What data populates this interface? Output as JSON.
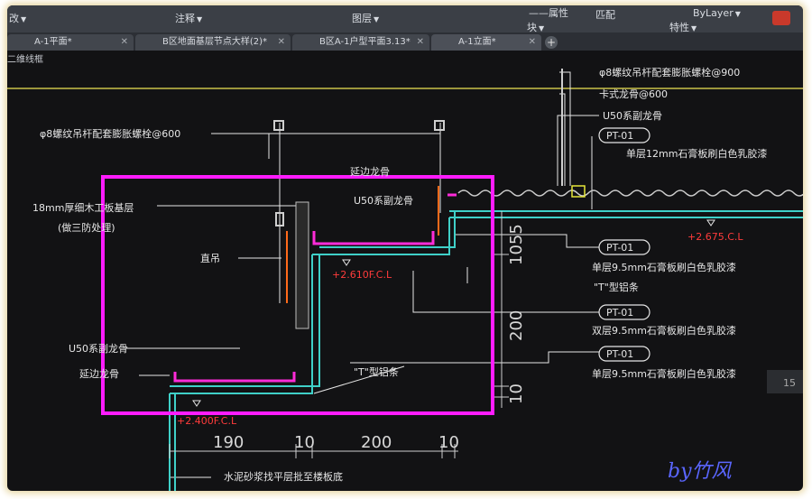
{
  "ribbon": {
    "left_label": "改",
    "annotation_label": "注释",
    "layer_label": "图层",
    "block_label": "块",
    "properties_label": "特性",
    "match_label": "匹配",
    "color_value": "ByLayer",
    "partial_label": "——属性"
  },
  "tabs": [
    {
      "label": "A-1平面*"
    },
    {
      "label": "B区地面基层节点大样(2)*"
    },
    {
      "label": "B区A-1户型平面3.13*"
    },
    {
      "label": "A-1立面*"
    }
  ],
  "new_tab_symbol": "+",
  "viewport_label": "二维线框",
  "drawing": {
    "callouts": {
      "top_bolt": "φ8螺纹吊杆配套膨胀螺栓@900",
      "left_bolt": "φ8螺纹吊杆配套膨胀螺栓@600",
      "clip_keel": "卡式龙骨@600",
      "u50_top": "U50系副龙骨",
      "u50_mid": "U50系副龙骨",
      "u50_left": "U50系副龙骨",
      "edge_keel_top": "延边龙骨",
      "edge_keel_left": "延边龙骨",
      "plywood_1": "18mm厚细木工板基层",
      "plywood_2": "(做三防处理)",
      "hanger": "直吊",
      "t_strip_1": "\"T\"型铝条",
      "t_strip_2": "\"T\"型铝条",
      "cement": "水泥砂浆找平层批至楼板底"
    },
    "pt_tags": [
      "PT-01",
      "PT-01",
      "PT-01",
      "PT-01"
    ],
    "pt_descriptions": [
      "单层12mm石膏板刷白色乳胶漆",
      "单层9.5mm石膏板刷白色乳胶漆",
      "双层9.5mm石膏板刷白色乳胶漆",
      "单层9.5mm石膏板刷白色乳胶漆"
    ],
    "elevations": [
      "+2.675.C.L",
      "+2.610F.C.L",
      "+2.400F.C.L"
    ],
    "vertical_dims": [
      "1055",
      "200",
      "10"
    ],
    "horizontal_dims": [
      "190",
      "10",
      "200",
      "10"
    ],
    "side_number": "15"
  },
  "signature": "by竹风",
  "colors": {
    "background": "#121214",
    "yellow_line": "#c9c24a",
    "highlight_box": "#ff1cff",
    "elevation_red": "#ff3b3b",
    "cyan_line": "#3fd0c8",
    "signature_blue": "#5a66ff"
  }
}
